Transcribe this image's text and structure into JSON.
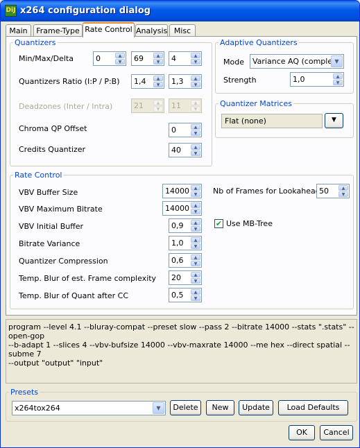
{
  "window": {
    "title": "x264 configuration dialog",
    "icon": "app-icon",
    "icon_text": "DiJ"
  },
  "tabs": [
    {
      "label": "Main"
    },
    {
      "label": "Frame-Type"
    },
    {
      "label": "Rate Control",
      "active": true
    },
    {
      "label": "Analysis"
    },
    {
      "label": "Misc"
    }
  ],
  "quantizers": {
    "title": "Quantizers",
    "min_max_delta_label": "Min/Max/Delta",
    "min": "0",
    "max": "69",
    "delta": "4",
    "ratio_label": "Quantizers Ratio (I:P / P:B)",
    "ratio_ip": "1,4",
    "ratio_pb": "1,3",
    "deadzones_label": "Deadzones (Inter / Intra)",
    "deadzone_inter": "21",
    "deadzone_intra": "11",
    "chroma_label": "Chroma QP Offset",
    "chroma": "0",
    "credits_label": "Credits Quantizer",
    "credits": "40"
  },
  "adaptive": {
    "title": "Adaptive Quantizers",
    "mode_label": "Mode",
    "mode": "Variance AQ (complexit",
    "strength_label": "Strength",
    "strength": "1,0"
  },
  "matrices": {
    "title": "Quantizer Matrices",
    "value": "Flat (none)"
  },
  "rate_control": {
    "title": "Rate Control",
    "rows": [
      {
        "label": "VBV Buffer Size",
        "value": "14000"
      },
      {
        "label": "VBV Maximum Bitrate",
        "value": "14000"
      },
      {
        "label": "VBV Initial Buffer",
        "value": "0,9"
      },
      {
        "label": "Bitrate Variance",
        "value": "1,0"
      },
      {
        "label": "Quantizer Compression",
        "value": "0,6"
      },
      {
        "label": "Temp. Blur of est. Frame complexity",
        "value": "20"
      },
      {
        "label": "Temp. Blur of Quant after CC",
        "value": "0,5"
      }
    ],
    "lookahead_label": "Nb of Frames for Lookahead",
    "lookahead": "50",
    "mbtree_label": "Use MB-Tree",
    "mbtree_checked": true,
    "mbtree_check_mark": "✔"
  },
  "commandline": {
    "line1": "program --level 4.1 --bluray-compat --preset slow --pass 2 --bitrate 14000 --stats \".stats\" --open-gop",
    "line2": "--b-adapt 1 --slices 4 --vbv-bufsize 14000 --vbv-maxrate 14000 --me hex --direct spatial --subme 7",
    "line3": "--output \"output\" \"input\""
  },
  "presets": {
    "title": "Presets",
    "selected": "x264tox264",
    "delete_label": "Delete",
    "new_label": "New",
    "update_label": "Update",
    "load_defaults_label": "Load Defaults"
  },
  "footer": {
    "ok_label": "OK",
    "cancel_label": "Cancel"
  },
  "icons": {
    "spin_up": "▲",
    "spin_down": "▼",
    "dropdown": "▼"
  }
}
